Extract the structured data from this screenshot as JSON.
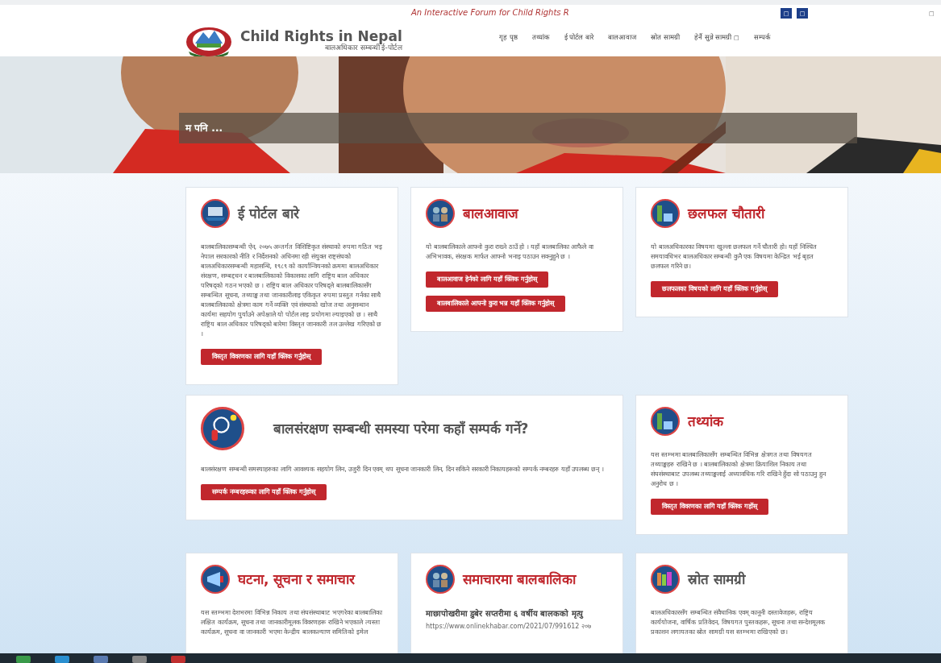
{
  "header": {
    "tagline": "An Interactive Forum for Child Rights R",
    "top_buttons": [
      "□",
      "□"
    ],
    "corner_mark": "□",
    "title": "Child Rights in Nepal",
    "subtitle": "बालअधिकार सम्बन्धी ई-पोर्टल",
    "nav": [
      {
        "label": "गृह पृष्ठ"
      },
      {
        "label": "तथ्यांक"
      },
      {
        "label": "ई पोर्टल बारे"
      },
      {
        "label": "बालआवाज"
      },
      {
        "label": "स्रोत सामग्री"
      },
      {
        "label": "हेर्नै सुन्ने सामग्री",
        "caret": "□"
      },
      {
        "label": "सम्पर्क"
      }
    ]
  },
  "hero": {
    "kind": "picture",
    "caption": "म पनि ..."
  },
  "rows": [
    [
      {
        "title": "ई पोर्टल बारे",
        "accent": false,
        "text": "बालबालिकासम्बन्धी ऐन, २०७५ अन्तर्गत विशिष्टिकृत संस्थाको रुपमा गठित भइ नेपाल सरकारको नीति र निर्देशनको अधिनमा रही संयुक्त राष्ट्संघको बालअधिकारसम्बन्धी महासन्धि, १९८९ को कार्यान्वियनको क्रममा बालअधिकार संरक्षण, सम्बद्दधन र बालबालिकाको विकासका लागि राष्ट्रिय बाल अधिकार परिषद्को गठन भएको छ । राष्ट्रिय बाल अधिकार परिषद्ले बालबालिकासँग सम्बन्धित सूचना, तथ्याङ्क तथा जानकारीलाइ एकिकृत रुपमा प्रस्तुत गर्नका साथै बालबालिकाको क्षेत्रमा काम गर्ने व्यक्ति एवं संस्थाको खोज तथा अनुसन्धान कार्यमा सहयोग पुर्याउने अपेक्षाले यो पोर्टल लाइ प्रयोगमा ल्याइएको छ । साथै राष्ट्रिय बाल अधिकार परिषद्को बारेमा विस्तृत जानकारी तल उल्लेख गरिएको छ ।",
        "buttons": [
          "विस्तृत विवरणका लागि यहाँ क्लिक गर्नुहोस्"
        ]
      },
      {
        "title": "बालआवाज",
        "accent": true,
        "text": "यो बालबालिकाले आफ्नो कुरा राख्ने ठाउँ हो । यहाँ बालबालिका आफैले वा अभिभावक, संरक्षक मार्फत आफ्नो भनाइ पठाउन सक्नुहुने छ ।",
        "buttons": [
          "बालआवाज हेर्नको लागि यहाँ क्लिक गर्नुहोस्",
          "बालबालिकाले आफ्नो कुरा भन्न यहाँ क्लिक गर्नुहोस्"
        ]
      },
      {
        "title": "छलफल चौतारी",
        "accent": true,
        "text": "यो बालअधिकारका विषयमा खुल्ला छलफल गर्ने चौतारी हो। यहाँ निश्चित समयावधिभर बालअधिकार सम्बन्धी कुनै एक विषयमा केन्द्रित भई बृहत छलफल गरिने छ।",
        "buttons": [
          "छलफलका विषयको लागि यहाँ क्लिक गर्नुहोस्"
        ]
      }
    ],
    [
      {
        "title": "बालसंरक्षण सम्बन्धी समस्या परेमा कहाँ सम्पर्क गर्ने?",
        "accent": false,
        "text": "बालसंरक्षण सम्बन्धी समस्याहरुका लागि आवश्यक सहयोग लिन, उजुरी दिन एवम् थप सूचना जानकारी लिन, दिन सकिने सरकारी निकायहरूको सम्पर्क नम्बरहरु यहाँ उपलब्ध छन् ।",
        "buttons": [
          "सम्पर्क नम्बरहरूका लागि यहाँ क्लिक गर्नुहोस्"
        ]
      },
      {
        "title": "तथ्यांक",
        "accent": true,
        "text": "यस स्तम्भमा बालबालिकासँग सम्बन्धित विभिन्न क्षेत्रगत तथा विषयगत तथ्याङ्कहरु राखिने छ । बालबालिकाको क्षेत्रमा क्रियाशिल निकाय तथा संघसंस्थाबाट उपलब्ध तथ्याङ्कलाई अध्यावधिक गरि राखिने हुँदा सो पठाउनु हुन अनुरोध छ ।",
        "buttons": [
          "विस्तृत विवरणका लागि यहाँ क्लिक गर्होस्"
        ]
      }
    ],
    [
      {
        "title": "घटना, सूचना र समाचार",
        "accent": true,
        "text": "यस स्तम्भमा देशभरमा विभिन्न निकाय तथा संघसंस्थाबाट भएगरेका बालबालिका लक्षित कार्यक्रम, सूचना तथा जानकारीमूलक विवरणहरू राखिने भएकाले त्यस्ता कार्यक्रम, सूचना वा जानकारी भएमा केन्द्रीय बालकल्याण समितिको इमेल"
      },
      {
        "title": "समाचारमा बालबालिका",
        "accent": true,
        "headline": "माछापोखरीमा डुबेर सप्तरीमा ६ वर्षीय बालकको मृत्यु",
        "link": "https://www.onlinekhabar.com/2021/07/991612 २०७"
      },
      {
        "title": "स्रोत सामग्री",
        "accent": false,
        "text": "बालअधिकारसँग सम्बन्धित संवैधानिक एवम् कानूनी दस्तावेजहरू, राष्ट्रिय कार्ययोजना, वार्षिक प्रतिवेदन, विषयगत पुस्तकहरू, सूचना तथा सन्देशमूलक प्रकाशन लगायतका स्रोत सामग्री यस स्तम्भमा राखिएको छ।"
      }
    ]
  ]
}
